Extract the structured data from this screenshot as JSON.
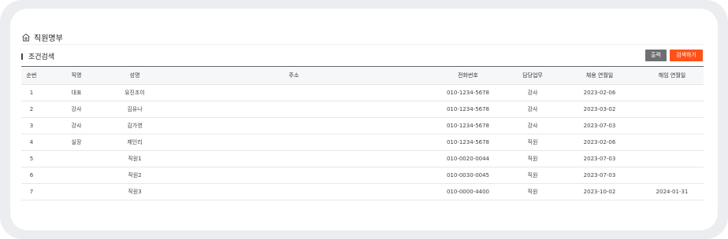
{
  "page": {
    "title": "직원명부",
    "section_title": "조건검색",
    "icon": "home-star-icon"
  },
  "actions": {
    "print_label": "출력",
    "search_label": "검색하기",
    "print_color": "#6d6f72",
    "search_color": "#ff5218"
  },
  "table": {
    "headers": [
      "순번",
      "직명",
      "성명",
      "주소",
      "전화번호",
      "담당업무",
      "채용 연월일",
      "해임 연월일"
    ],
    "rows": [
      [
        "1",
        "대표",
        "유진조이",
        "",
        "010-1234-5678",
        "강사",
        "2023-02-06",
        ""
      ],
      [
        "2",
        "강사",
        "김유나",
        "",
        "010-1234-5678",
        "강사",
        "2023-03-02",
        ""
      ],
      [
        "3",
        "강사",
        "김가영",
        "",
        "010-1234-5678",
        "강사",
        "2023-07-03",
        ""
      ],
      [
        "4",
        "실장",
        "제인리",
        "",
        "010-1234-5678",
        "직원",
        "2023-02-06",
        ""
      ],
      [
        "5",
        "",
        "직원1",
        "",
        "010-0020-0044",
        "직원",
        "2023-07-03",
        ""
      ],
      [
        "6",
        "",
        "직원2",
        "",
        "010-0030-0045",
        "직원",
        "2023-07-03",
        ""
      ],
      [
        "7",
        "",
        "직원3",
        "",
        "010-0000-4400",
        "직원",
        "2023-10-02",
        "2024-01-31"
      ]
    ]
  }
}
